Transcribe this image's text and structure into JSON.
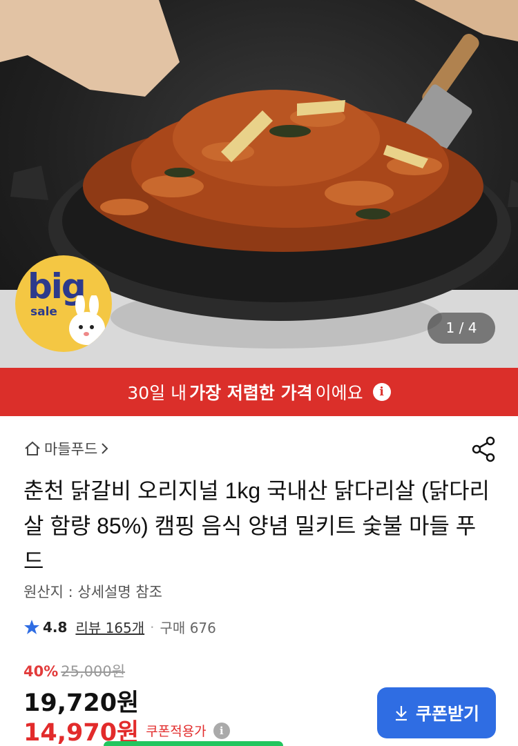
{
  "hero": {
    "badge": {
      "big": "big",
      "sale": "sale"
    },
    "pager": "1 / 4"
  },
  "banner": {
    "prefix": "30일 내 ",
    "emphasis": "가장 저렴한 가격",
    "suffix": "이에요",
    "info_icon": "i"
  },
  "product": {
    "store_name": "마들푸드",
    "title": "춘천 닭갈비 오리지널 1kg 국내산 닭다리살 (닭다리살 함량 85%) 캠핑 음식 양념 밀키트 숯불 마들 푸드",
    "origin": "원산지 : 상세설명 참조",
    "rating": "4.8",
    "reviews": "리뷰 165개",
    "purchases": "구매 676",
    "discount_pct": "40%",
    "original_price": "25,000원",
    "price": "19,720원",
    "coupon_price": "14,970원",
    "coupon_label": "쿠폰적용가",
    "coupon_button": "쿠폰받기"
  },
  "colors": {
    "banner_red": "#db2f2a",
    "price_red": "#e22b2b",
    "coupon_blue": "#2f6de3",
    "badge_yellow": "#f4c743"
  },
  "icons": [
    "home-icon",
    "chevron-right-icon",
    "share-icon",
    "star-icon",
    "info-icon",
    "download-icon"
  ]
}
